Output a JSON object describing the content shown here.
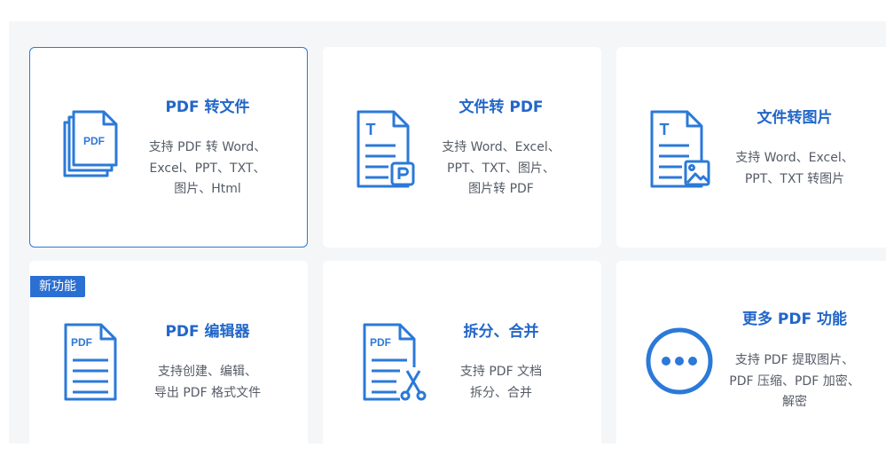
{
  "cards": [
    {
      "title": "PDF 转文件",
      "desc": [
        "支持 PDF 转 Word、",
        "Excel、PPT、TXT、",
        "图片、Html"
      ],
      "icon": "pdf-stack-icon",
      "icon_text": "PDF"
    },
    {
      "title": "文件转 PDF",
      "desc": [
        "支持 Word、Excel、",
        "PPT、TXT、图片、",
        "图片转 PDF"
      ],
      "icon": "doc-to-pdf-icon",
      "icon_text": "T"
    },
    {
      "title": "文件转图片",
      "desc": [
        "支持 Word、Excel、",
        "PPT、TXT 转图片"
      ],
      "icon": "doc-to-image-icon",
      "icon_text": "T"
    },
    {
      "title": "PDF 编辑器",
      "desc": [
        "支持创建、编辑、",
        "导出 PDF 格式文件"
      ],
      "icon": "pdf-edit-icon",
      "icon_text": "PDF",
      "badge": "新功能"
    },
    {
      "title": "拆分、合并",
      "desc": [
        "支持 PDF 文档",
        "拆分、合并"
      ],
      "icon": "pdf-split-icon",
      "icon_text": "PDF"
    },
    {
      "title": "更多 PDF 功能",
      "desc": [
        "支持 PDF 提取图片、",
        "PDF 压缩、PDF 加密、",
        "解密"
      ],
      "icon": "more-icon"
    }
  ],
  "colors": {
    "accent": "#2b79d8",
    "title": "#2266c8",
    "text": "#555b66",
    "panel": "#f5f6f8"
  }
}
